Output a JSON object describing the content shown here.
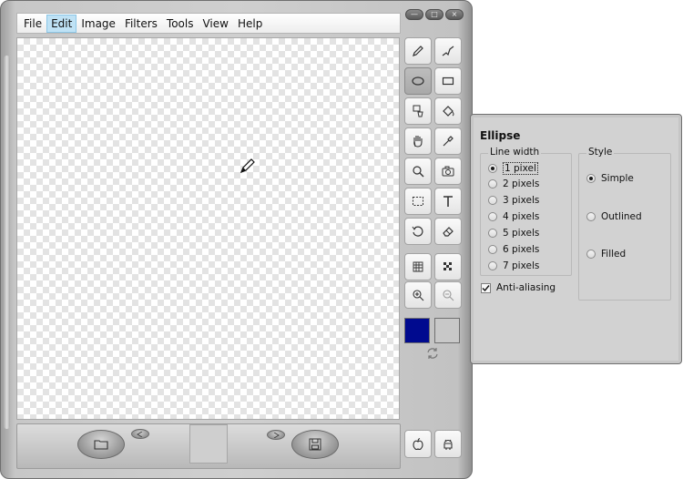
{
  "menubar": {
    "items": [
      {
        "label": "File"
      },
      {
        "label": "Edit"
      },
      {
        "label": "Image"
      },
      {
        "label": "Filters"
      },
      {
        "label": "Tools"
      },
      {
        "label": "View"
      },
      {
        "label": "Help"
      }
    ],
    "active_index": 1
  },
  "window_controls": {
    "minimize": "—",
    "maximize": "□",
    "close": "×"
  },
  "tools": [
    {
      "name": "pencil-icon"
    },
    {
      "name": "line-icon"
    },
    {
      "name": "ellipse-icon",
      "selected": true
    },
    {
      "name": "rectangle-icon"
    },
    {
      "name": "fill-bucket-icon"
    },
    {
      "name": "paint-bucket-icon"
    },
    {
      "name": "hand-icon"
    },
    {
      "name": "eyedropper-icon"
    },
    {
      "name": "magnifier-icon"
    },
    {
      "name": "camera-icon"
    },
    {
      "name": "selection-icon"
    },
    {
      "name": "text-icon"
    },
    {
      "name": "rotate-icon"
    },
    {
      "name": "eraser-icon"
    },
    {
      "name": "grid-icon"
    },
    {
      "name": "pattern-icon"
    },
    {
      "name": "zoom-in-icon"
    },
    {
      "name": "zoom-out-icon"
    }
  ],
  "colors": {
    "primary": "#000a8f",
    "secondary": "#c8c8c8"
  },
  "options": {
    "title": "Ellipse",
    "line_width": {
      "label": "Line width",
      "options": [
        "1 pixel",
        "2 pixels",
        "3 pixels",
        "4 pixels",
        "5 pixels",
        "6 pixels",
        "7 pixels"
      ],
      "selected": "1 pixel"
    },
    "style": {
      "label": "Style",
      "options": [
        "Simple",
        "Outlined",
        "Filled"
      ],
      "selected": "Simple"
    },
    "anti_aliasing": {
      "label": "Anti-aliasing",
      "checked": true
    }
  }
}
